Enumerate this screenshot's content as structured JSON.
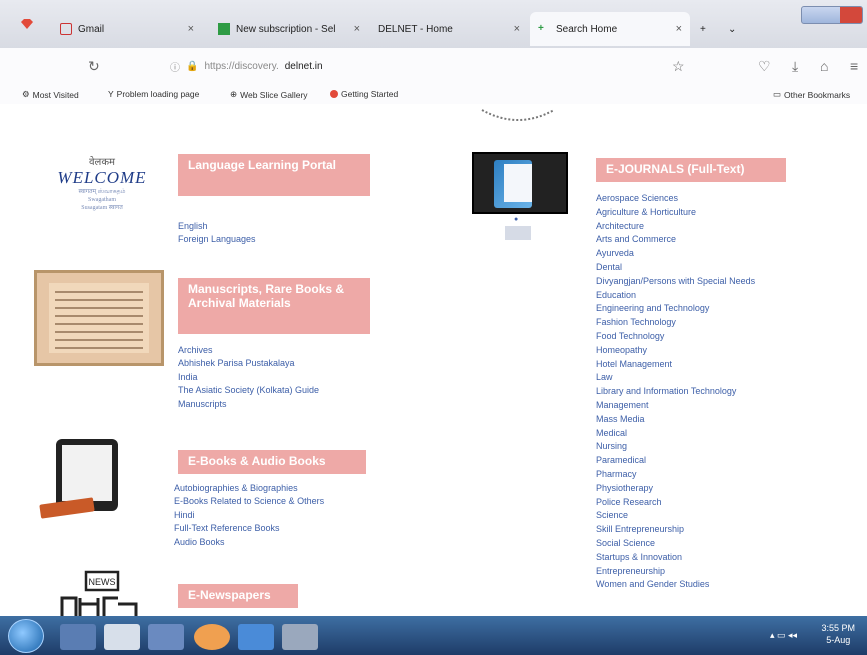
{
  "browser": {
    "tabs": [
      {
        "label": "Gmail",
        "close": "×",
        "active": false
      },
      {
        "label": "New subscription - Sel",
        "close": "×",
        "active": false
      },
      {
        "label": "DELNET - Home",
        "close": "×",
        "active": false
      },
      {
        "label": "Search Home",
        "close": "×",
        "active": true
      }
    ],
    "new_tab": "+",
    "address": {
      "faded": "https://discovery.",
      "domain": "delnet.in"
    },
    "bookmarks": [
      "Most Visited",
      "Problem loading page",
      "Web Slice Gallery",
      "Getting Started"
    ],
    "other_bookmarks": "Other Bookmarks"
  },
  "welcome": {
    "top": "वेलकम",
    "main": "WELCOME",
    "line1": "स्वागतम्   ஸ்வாகதம்",
    "line2": "Swagatham",
    "line3": "Susagatam   स्वागत"
  },
  "sections": {
    "language": {
      "title": "Language Learning Portal",
      "links": [
        "English",
        "Foreign Languages"
      ]
    },
    "manuscripts": {
      "title": "Manuscripts, Rare Books & Archival Materials",
      "links": [
        "Archives",
        "Abhishek Parisa Pustakalaya",
        "India",
        "The Asiatic Society (Kolkata) Guide",
        "Manuscripts"
      ]
    },
    "ebooks": {
      "title": "E-Books & Audio Books",
      "links": [
        "Autobiographies & Biographies",
        "E-Books Related to Science & Others",
        "Hindi",
        "Full-Text Reference Books",
        "Audio Books"
      ]
    },
    "newspapers": {
      "title": "E-Newspapers"
    },
    "ejournals": {
      "title": "E-JOURNALS (Full-Text)",
      "links": [
        "Aerospace Sciences",
        "Agriculture & Horticulture",
        "Architecture",
        "Arts and Commerce",
        "Ayurveda",
        "Dental",
        "Divyangjan/Persons with Special Needs",
        "Education",
        "Engineering and Technology",
        "Fashion Technology",
        "Food Technology",
        "Homeopathy",
        "Hotel Management",
        "Law",
        "Library and Information Technology",
        "Management",
        "Mass Media",
        "Medical",
        "Nursing",
        "Paramedical",
        "Pharmacy",
        "Physiotherapy",
        "Police Research",
        "Science",
        "Skill Entrepreneurship",
        "Social Science",
        "Startups & Innovation",
        "Entrepreneurship",
        "Women and Gender Studies"
      ]
    }
  },
  "news_icon_label": "NEWS",
  "taskbar": {
    "time": "3:55 PM",
    "date": "5-Aug"
  },
  "colors": {
    "section_bg": "#eea9a7",
    "link": "#3d5fa8",
    "taskbar": "#1e3c68"
  }
}
